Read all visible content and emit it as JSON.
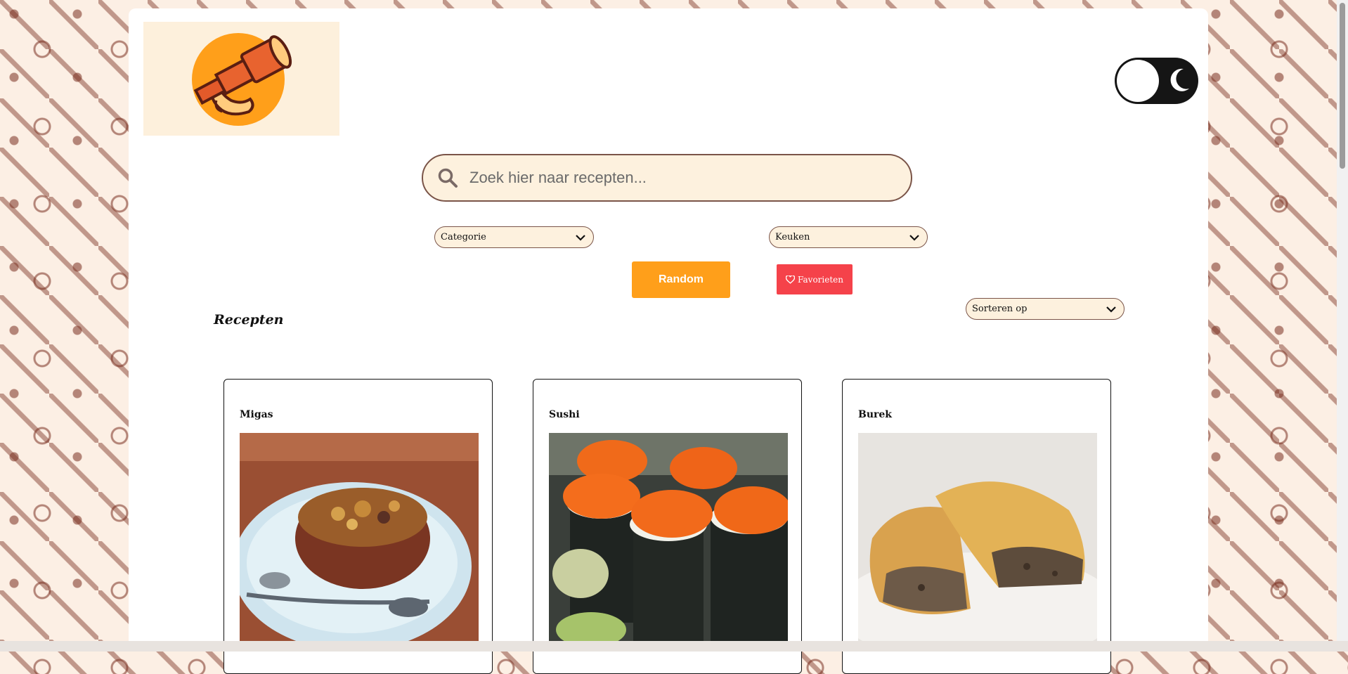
{
  "search": {
    "placeholder": "Zoek hier naar recepten..."
  },
  "filters": {
    "category": {
      "selected": "Categorie"
    },
    "cuisine": {
      "selected": "Keuken"
    },
    "sort": {
      "selected": "Sorteren op"
    }
  },
  "buttons": {
    "random_label": "Random",
    "favorites_label": "Favorieten"
  },
  "section": {
    "title": "Recepten"
  },
  "recipes": [
    {
      "title": "Migas"
    },
    {
      "title": "Sushi"
    },
    {
      "title": "Burek"
    }
  ],
  "colors": {
    "accent_orange": "#ff9f1a",
    "favorites_red": "#f5424a",
    "field_background": "#fdf1de",
    "border_brown": "#7a5448"
  },
  "icons": {
    "logo": "telescope-croissant-logo",
    "search": "search-icon",
    "toggle": "moon-icon",
    "favorites": "heart-icon",
    "dropdown": "chevron-down-icon"
  }
}
